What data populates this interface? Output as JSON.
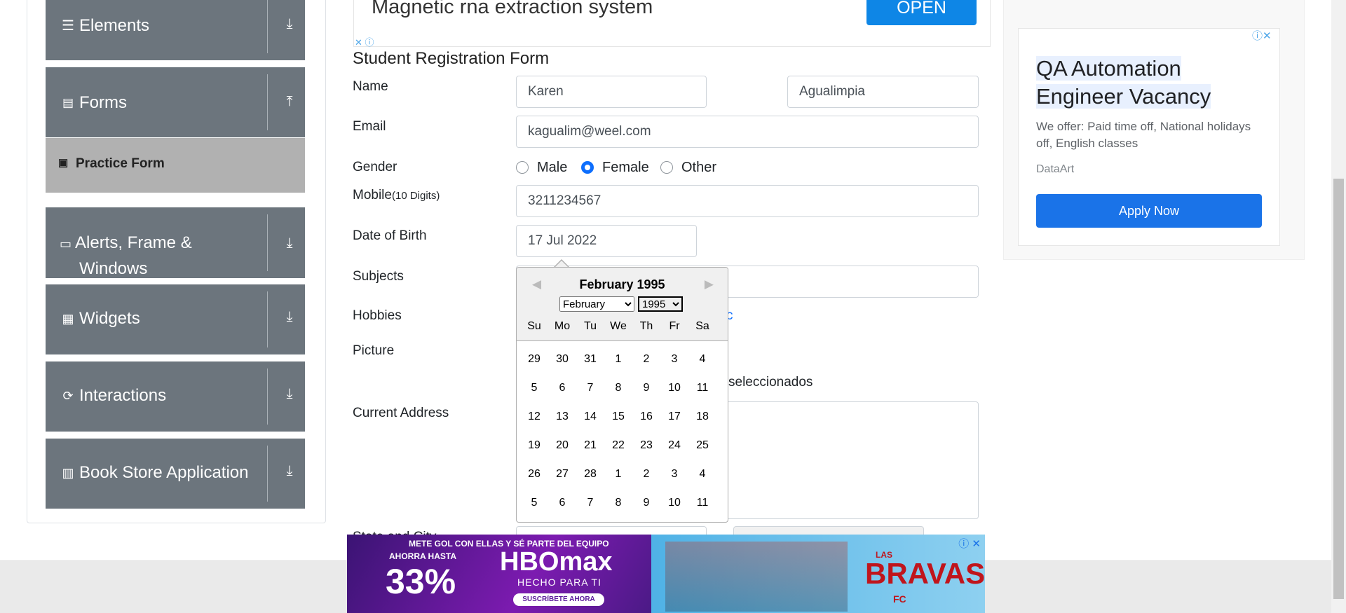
{
  "sidebar": {
    "groups": [
      {
        "label": "Elements",
        "icon": "hamburger-icon",
        "arrow": "download-arrow-icon"
      },
      {
        "label": "Forms",
        "icon": "document-icon",
        "arrow": "upload-arrow-icon"
      },
      {
        "label": "Alerts, Frame &",
        "label2": "Windows",
        "icon": "window-icon",
        "arrow": "download-arrow-icon"
      },
      {
        "label": "Widgets",
        "icon": "widgets-icon",
        "arrow": "download-arrow-icon"
      },
      {
        "label": "Interactions",
        "icon": "interactions-icon",
        "arrow": "download-arrow-icon"
      },
      {
        "label": "Book Store Application",
        "icon": "books-icon",
        "arrow": "download-arrow-icon"
      }
    ],
    "active_item": "Practice Form"
  },
  "top_ad": {
    "text": "Magnetic rna extraction system",
    "button": "OPEN"
  },
  "form": {
    "title": "Student Registration Form",
    "labels": {
      "name": "Name",
      "email": "Email",
      "gender": "Gender",
      "mobile": "Mobile",
      "mobile_hint": "(10 Digits)",
      "dob": "Date of Birth",
      "subjects": "Subjects",
      "hobbies": "Hobbies",
      "picture": "Picture",
      "address": "Current Address",
      "state_city": "State and City"
    },
    "first_name": "Karen",
    "last_name": "Agualimpia",
    "email": "kagualim@weel.com",
    "genders": [
      "Male",
      "Female",
      "Other"
    ],
    "selected_gender": "Female",
    "mobile": "3211234567",
    "dob": "17 Jul 2022",
    "hobbies_partial": "c",
    "picture_partial": "seleccionados"
  },
  "datepicker": {
    "title": "February 1995",
    "month_select": "February",
    "year_select": "1995",
    "day_names": [
      "Su",
      "Mo",
      "Tu",
      "We",
      "Th",
      "Fr",
      "Sa"
    ],
    "weeks": [
      [
        "29",
        "30",
        "31",
        "1",
        "2",
        "3",
        "4"
      ],
      [
        "5",
        "6",
        "7",
        "8",
        "9",
        "10",
        "11"
      ],
      [
        "12",
        "13",
        "14",
        "15",
        "16",
        "17",
        "18"
      ],
      [
        "19",
        "20",
        "21",
        "22",
        "23",
        "24",
        "25"
      ],
      [
        "26",
        "27",
        "28",
        "1",
        "2",
        "3",
        "4"
      ],
      [
        "5",
        "6",
        "7",
        "8",
        "9",
        "10",
        "11"
      ]
    ]
  },
  "right_ad": {
    "title": "QA Automation Engineer Vacancy",
    "desc": "We offer: Paid time off, National holidays off, English classes",
    "brand": "DataArt",
    "button": "Apply Now"
  },
  "bottom_ad": {
    "line1": "METE GOL CON ELLAS Y SÉ PARTE DEL EQUIPO",
    "line2": "AHORRA HASTA",
    "percent": "33%",
    "brand": "HBOmax",
    "tagline": "HECHO PARA TI",
    "cta": "SUSCRÍBETE AHORA",
    "show_top": "LAS",
    "show": "BRAVAS",
    "show_sub": "FC"
  },
  "colors": {
    "sidebar": "#6c757d",
    "accent": "#0d6efd",
    "ad_button": "#1a73e8"
  }
}
